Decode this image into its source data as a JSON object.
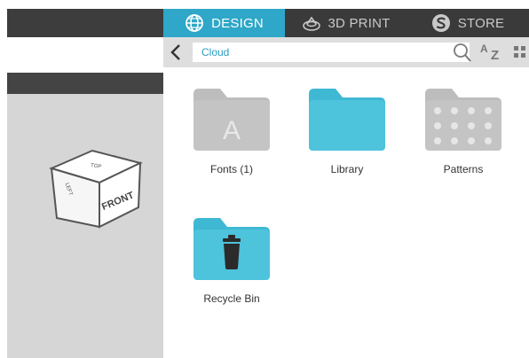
{
  "tabs": [
    {
      "label": "DESIGN",
      "icon": "globe-icon",
      "active": true
    },
    {
      "label": "3D PRINT",
      "icon": "3d-print-icon",
      "active": false
    },
    {
      "label": "STORE",
      "icon": "store-icon",
      "active": false
    }
  ],
  "view_cube": {
    "top": "TOP",
    "left": "LEFT",
    "front": "FRONT"
  },
  "nav": {
    "path": "Cloud"
  },
  "sort": {
    "a": "A",
    "z": "Z"
  },
  "files": [
    {
      "label": "Fonts (1)",
      "icon": "font-folder-icon",
      "glyph": "A"
    },
    {
      "label": "Library",
      "icon": "folder-icon"
    },
    {
      "label": "Patterns",
      "icon": "pattern-folder-icon"
    },
    {
      "label": "Recycle Bin",
      "icon": "recycle-bin-icon"
    }
  ],
  "colors": {
    "accent": "#2ea7c8",
    "folder_blue": "#4dc3dc",
    "folder_gray": "#bdbdbd",
    "dark_bar": "#3a3a3a"
  }
}
